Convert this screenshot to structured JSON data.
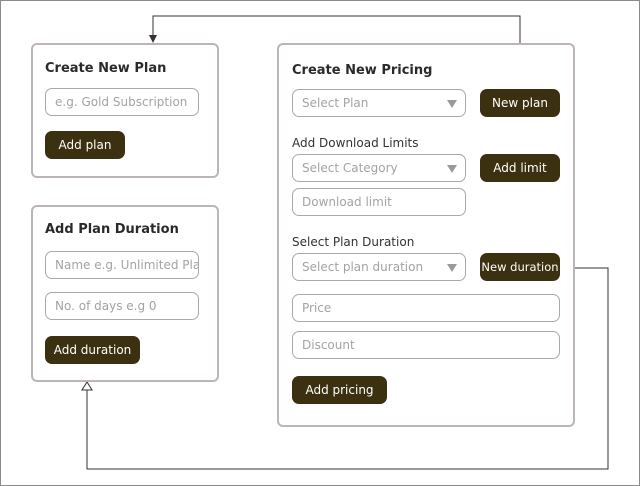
{
  "create_plan": {
    "title": "Create New Plan",
    "plan_name_placeholder": "e.g. Gold Subscription",
    "add_plan_label": "Add plan"
  },
  "plan_duration": {
    "title": "Add Plan Duration",
    "name_placeholder": "Name e.g. Unlimited Plan",
    "days_placeholder": "No. of days e.g 0",
    "add_duration_label": "Add duration"
  },
  "pricing": {
    "title": "Create New Pricing",
    "select_plan_placeholder": "Select Plan",
    "new_plan_label": "New plan",
    "download_limits_label": "Add Download Limits",
    "select_category_placeholder": "Select Category",
    "add_limit_label": "Add limit",
    "download_limit_placeholder": "Download limit",
    "plan_duration_label": "Select Plan Duration",
    "select_duration_placeholder": "Select plan duration",
    "new_duration_label": "New duration",
    "price_placeholder": "Price",
    "discount_placeholder": "Discount",
    "add_pricing_label": "Add pricing"
  },
  "colors": {
    "button": "#3b300f",
    "card_border": "#bdb5b5",
    "connector": "#333333"
  }
}
